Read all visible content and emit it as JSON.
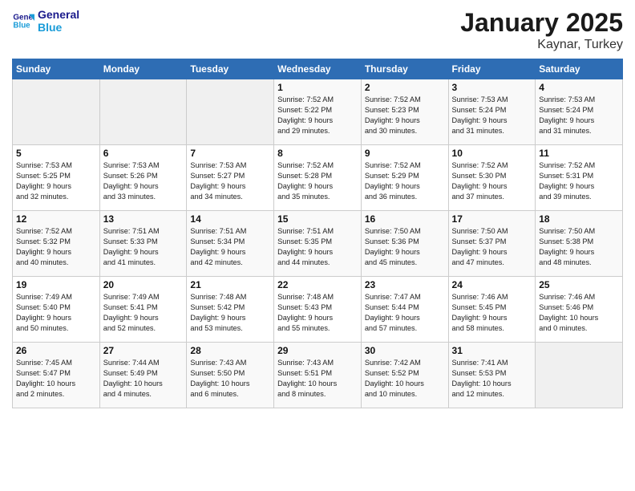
{
  "logo": {
    "line1": "General",
    "line2": "Blue"
  },
  "title": "January 2025",
  "subtitle": "Kaynar, Turkey",
  "days_of_week": [
    "Sunday",
    "Monday",
    "Tuesday",
    "Wednesday",
    "Thursday",
    "Friday",
    "Saturday"
  ],
  "weeks": [
    [
      {
        "day": "",
        "info": ""
      },
      {
        "day": "",
        "info": ""
      },
      {
        "day": "",
        "info": ""
      },
      {
        "day": "1",
        "info": "Sunrise: 7:52 AM\nSunset: 5:22 PM\nDaylight: 9 hours\nand 29 minutes."
      },
      {
        "day": "2",
        "info": "Sunrise: 7:52 AM\nSunset: 5:23 PM\nDaylight: 9 hours\nand 30 minutes."
      },
      {
        "day": "3",
        "info": "Sunrise: 7:53 AM\nSunset: 5:24 PM\nDaylight: 9 hours\nand 31 minutes."
      },
      {
        "day": "4",
        "info": "Sunrise: 7:53 AM\nSunset: 5:24 PM\nDaylight: 9 hours\nand 31 minutes."
      }
    ],
    [
      {
        "day": "5",
        "info": "Sunrise: 7:53 AM\nSunset: 5:25 PM\nDaylight: 9 hours\nand 32 minutes."
      },
      {
        "day": "6",
        "info": "Sunrise: 7:53 AM\nSunset: 5:26 PM\nDaylight: 9 hours\nand 33 minutes."
      },
      {
        "day": "7",
        "info": "Sunrise: 7:53 AM\nSunset: 5:27 PM\nDaylight: 9 hours\nand 34 minutes."
      },
      {
        "day": "8",
        "info": "Sunrise: 7:52 AM\nSunset: 5:28 PM\nDaylight: 9 hours\nand 35 minutes."
      },
      {
        "day": "9",
        "info": "Sunrise: 7:52 AM\nSunset: 5:29 PM\nDaylight: 9 hours\nand 36 minutes."
      },
      {
        "day": "10",
        "info": "Sunrise: 7:52 AM\nSunset: 5:30 PM\nDaylight: 9 hours\nand 37 minutes."
      },
      {
        "day": "11",
        "info": "Sunrise: 7:52 AM\nSunset: 5:31 PM\nDaylight: 9 hours\nand 39 minutes."
      }
    ],
    [
      {
        "day": "12",
        "info": "Sunrise: 7:52 AM\nSunset: 5:32 PM\nDaylight: 9 hours\nand 40 minutes."
      },
      {
        "day": "13",
        "info": "Sunrise: 7:51 AM\nSunset: 5:33 PM\nDaylight: 9 hours\nand 41 minutes."
      },
      {
        "day": "14",
        "info": "Sunrise: 7:51 AM\nSunset: 5:34 PM\nDaylight: 9 hours\nand 42 minutes."
      },
      {
        "day": "15",
        "info": "Sunrise: 7:51 AM\nSunset: 5:35 PM\nDaylight: 9 hours\nand 44 minutes."
      },
      {
        "day": "16",
        "info": "Sunrise: 7:50 AM\nSunset: 5:36 PM\nDaylight: 9 hours\nand 45 minutes."
      },
      {
        "day": "17",
        "info": "Sunrise: 7:50 AM\nSunset: 5:37 PM\nDaylight: 9 hours\nand 47 minutes."
      },
      {
        "day": "18",
        "info": "Sunrise: 7:50 AM\nSunset: 5:38 PM\nDaylight: 9 hours\nand 48 minutes."
      }
    ],
    [
      {
        "day": "19",
        "info": "Sunrise: 7:49 AM\nSunset: 5:40 PM\nDaylight: 9 hours\nand 50 minutes."
      },
      {
        "day": "20",
        "info": "Sunrise: 7:49 AM\nSunset: 5:41 PM\nDaylight: 9 hours\nand 52 minutes."
      },
      {
        "day": "21",
        "info": "Sunrise: 7:48 AM\nSunset: 5:42 PM\nDaylight: 9 hours\nand 53 minutes."
      },
      {
        "day": "22",
        "info": "Sunrise: 7:48 AM\nSunset: 5:43 PM\nDaylight: 9 hours\nand 55 minutes."
      },
      {
        "day": "23",
        "info": "Sunrise: 7:47 AM\nSunset: 5:44 PM\nDaylight: 9 hours\nand 57 minutes."
      },
      {
        "day": "24",
        "info": "Sunrise: 7:46 AM\nSunset: 5:45 PM\nDaylight: 9 hours\nand 58 minutes."
      },
      {
        "day": "25",
        "info": "Sunrise: 7:46 AM\nSunset: 5:46 PM\nDaylight: 10 hours\nand 0 minutes."
      }
    ],
    [
      {
        "day": "26",
        "info": "Sunrise: 7:45 AM\nSunset: 5:47 PM\nDaylight: 10 hours\nand 2 minutes."
      },
      {
        "day": "27",
        "info": "Sunrise: 7:44 AM\nSunset: 5:49 PM\nDaylight: 10 hours\nand 4 minutes."
      },
      {
        "day": "28",
        "info": "Sunrise: 7:43 AM\nSunset: 5:50 PM\nDaylight: 10 hours\nand 6 minutes."
      },
      {
        "day": "29",
        "info": "Sunrise: 7:43 AM\nSunset: 5:51 PM\nDaylight: 10 hours\nand 8 minutes."
      },
      {
        "day": "30",
        "info": "Sunrise: 7:42 AM\nSunset: 5:52 PM\nDaylight: 10 hours\nand 10 minutes."
      },
      {
        "day": "31",
        "info": "Sunrise: 7:41 AM\nSunset: 5:53 PM\nDaylight: 10 hours\nand 12 minutes."
      },
      {
        "day": "",
        "info": ""
      }
    ]
  ]
}
